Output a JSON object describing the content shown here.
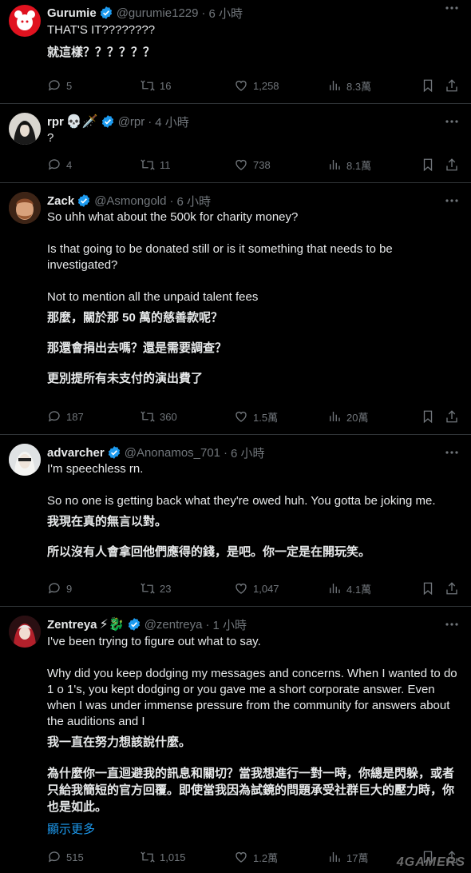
{
  "tweets": [
    {
      "name": "Gurumie",
      "handle": "@gurumie1229",
      "dot": "·",
      "time": "6 小時",
      "lines": [
        "THAT'S IT????????",
        "就這樣？？？？？？"
      ],
      "replies": "5",
      "reposts": "16",
      "likes": "1,258",
      "views": "8.3萬"
    },
    {
      "name": "rpr",
      "badges": "💀🗡️",
      "handle": "@rpr",
      "dot": "·",
      "time": "4 小時",
      "lines": [
        "?"
      ],
      "replies": "4",
      "reposts": "11",
      "likes": "738",
      "views": "8.1萬"
    },
    {
      "name": "Zack",
      "handle": "@Asmongold",
      "dot": "·",
      "time": "6 小時",
      "lines": [
        "So uhh what about the 500k for charity money?",
        "Is that going to be donated still or is it something that needs to be investigated?",
        "Not to mention all the unpaid talent fees",
        "那麼，關於那 50 萬的慈善款呢？",
        "那還會捐出去嗎？還是需要調查？",
        "更別提所有未支付的演出費了"
      ],
      "replies": "187",
      "reposts": "360",
      "likes": "1.5萬",
      "views": "20萬"
    },
    {
      "name": "advarcher",
      "handle": "@Anonamos_701",
      "dot": "·",
      "time": "6 小時",
      "lines": [
        "I'm speechless rn.",
        "So no one is getting back what they're owed huh. You gotta be joking me.",
        "我現在真的無言以對。",
        "所以沒有人會拿回他們應得的錢，是吧。你一定是在開玩笑。"
      ],
      "replies": "9",
      "reposts": "23",
      "likes": "1,047",
      "views": "4.1萬"
    },
    {
      "name": "Zentreya",
      "badges": "⚡🐉",
      "handle": "@zentreya",
      "dot": "·",
      "time": "1 小時",
      "lines": [
        "I've been trying to figure out what to say.",
        "Why did you keep dodging my messages and concerns. When I wanted to do 1 o 1's, you kept dodging or you gave me a short corporate answer. Even when I was under immense pressure from the community for answers about the auditions and I",
        "我一直在努力想該說什麼。",
        "為什麼你一直迴避我的訊息和關切？當我想進行一對一時，你總是閃躲，或者只給我簡短的官方回覆。即使當我因為試鏡的問題承受社群巨大的壓力時，你也是如此。"
      ],
      "show_more": "顯示更多",
      "replies": "515",
      "reposts": "1,015",
      "likes": "1.2萬",
      "views": "17萬"
    }
  ],
  "watermark": "4GAMERS",
  "icons": [
    "reply-icon",
    "repost-icon",
    "like-icon",
    "views-icon",
    "bookmark-icon",
    "share-icon",
    "more-icon",
    "verified-icon"
  ],
  "colors": {
    "background": "#000000",
    "text": "#e7e9ea",
    "muted": "#71767b",
    "verified": "#1d9bf0",
    "link": "#1d9bf0"
  }
}
